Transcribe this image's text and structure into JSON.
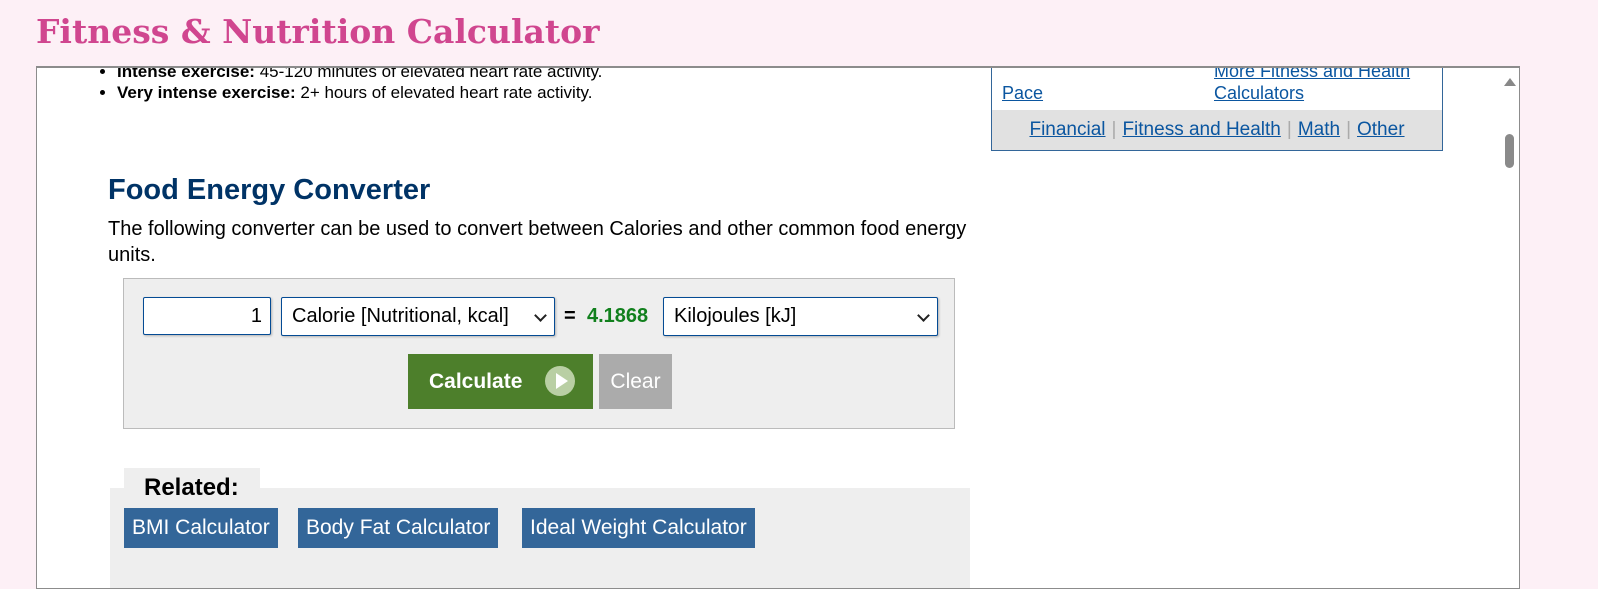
{
  "app_title": "Fitness & Nutrition Calculator",
  "activity_levels": [
    {
      "label": "Intense exercise:",
      "text": "45-120 minutes of elevated heart rate activity."
    },
    {
      "label": "Very intense exercise:",
      "text": "2+ hours of elevated heart rate activity."
    }
  ],
  "sidebar": {
    "links": {
      "pace": "Pace",
      "more_line1": "More Fitness and Health",
      "more_line2": "Calculators"
    },
    "categories": [
      "Financial",
      "Fitness and Health",
      "Math",
      "Other"
    ]
  },
  "converter": {
    "title": "Food Energy Converter",
    "description": "The following converter can be used to convert between Calories and other common food energy units.",
    "quantity_value": "1",
    "from_unit": "Calorie [Nutritional, kcal]",
    "equals": "=",
    "result": "4.1868",
    "to_unit": "Kilojoules [kJ]",
    "calculate_label": "Calculate",
    "clear_label": "Clear"
  },
  "related": {
    "heading": "Related:",
    "links": [
      "BMI Calculator",
      "Body Fat Calculator",
      "Ideal Weight Calculator"
    ]
  },
  "colors": {
    "title_pink": "#d0468f",
    "heading_navy": "#003366",
    "result_green": "#11801d",
    "calculate_green": "#4d7f2b",
    "related_blue": "#336699",
    "link_blue": "#0b56a0"
  }
}
